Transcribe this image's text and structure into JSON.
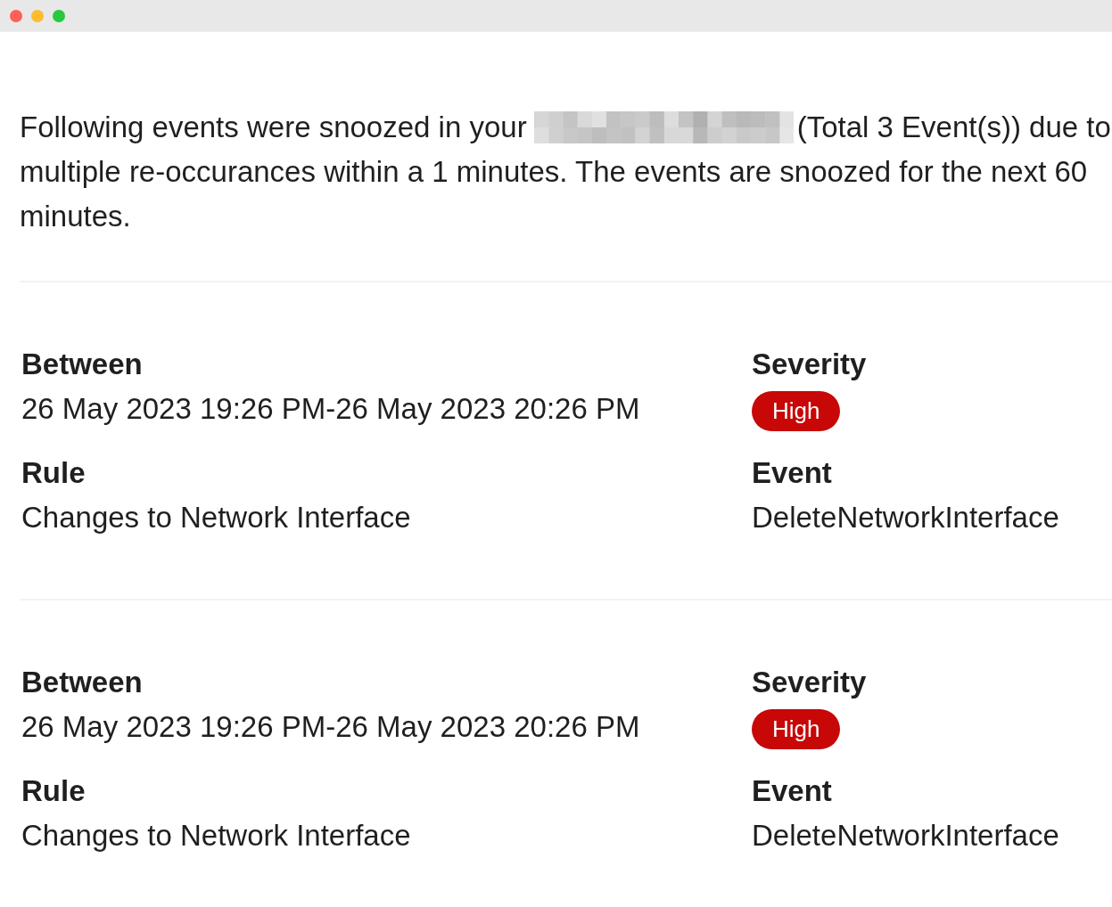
{
  "message": [
    {
      "kind": "text",
      "text": "Following events were snoozed in your"
    },
    {
      "kind": "redacted"
    },
    {
      "kind": "text",
      "text": "(Total 3 Event(s)) due to multiple re-occurances within a 1 minutes. The events are snoozed for the next 60 minutes."
    }
  ],
  "events": [
    {
      "fields": [
        {
          "kind": "text",
          "label": "Between",
          "value": "26 May 2023 19:26 PM-26 May 2023 20:26 PM"
        },
        {
          "kind": "badge",
          "label": "Severity",
          "value": "High"
        },
        {
          "kind": "text",
          "label": "Rule",
          "value": "Changes to Network Interface"
        },
        {
          "kind": "text",
          "label": "Event",
          "value": "DeleteNetworkInterface"
        }
      ]
    },
    {
      "fields": [
        {
          "kind": "text",
          "label": "Between",
          "value": "26 May 2023 19:26 PM-26 May 2023 20:26 PM"
        },
        {
          "kind": "badge",
          "label": "Severity",
          "value": "High"
        },
        {
          "kind": "text",
          "label": "Rule",
          "value": "Changes to Network Interface"
        },
        {
          "kind": "text",
          "label": "Event",
          "value": "DeleteNetworkInterface"
        }
      ]
    }
  ]
}
